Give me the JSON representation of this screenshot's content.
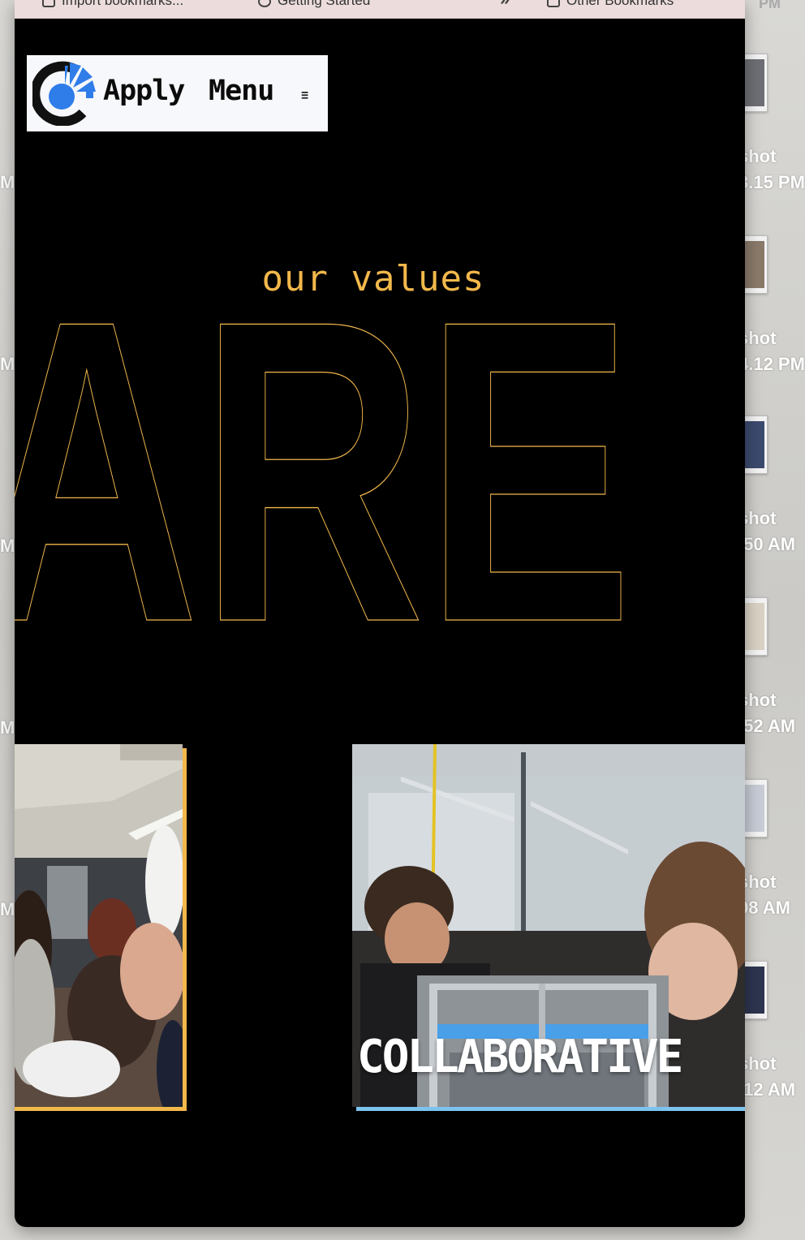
{
  "desktop": {
    "clock_fragment": "PM",
    "left_fragments": [
      "M",
      "M",
      "M",
      "M",
      "M"
    ],
    "items": [
      {
        "label1": "shot",
        "label2": "3.15 PM"
      },
      {
        "label1": "shot",
        "label2": "4.12 PM"
      },
      {
        "label1": "shot",
        "label2": ".50 AM"
      },
      {
        "label1": "shot",
        "label2": ".52 AM"
      },
      {
        "label1": "shot",
        "label2": "08 AM"
      },
      {
        "label1": "shot",
        "label2": ".12 AM"
      }
    ]
  },
  "browser": {
    "bookmarks": [
      {
        "label": "Import bookmarks...",
        "icon": "folder-icon"
      },
      {
        "label": "Getting Started",
        "icon": "globe-icon"
      },
      {
        "label": "Other Bookmarks",
        "icon": "folder-icon"
      }
    ],
    "overflow_chevron": "»"
  },
  "header": {
    "apply_label": "Apply",
    "menu_label": "Menu",
    "menu_icon": "≡"
  },
  "hero": {
    "eyebrow": "our values",
    "big_word": "ARE"
  },
  "cards": {
    "right_label": "COLLABORATIVE"
  },
  "colors": {
    "accent_gold": "#f2b84b",
    "accent_blue": "#7cc4ef",
    "logo_blue": "#2f7de9",
    "background": "#000000"
  }
}
